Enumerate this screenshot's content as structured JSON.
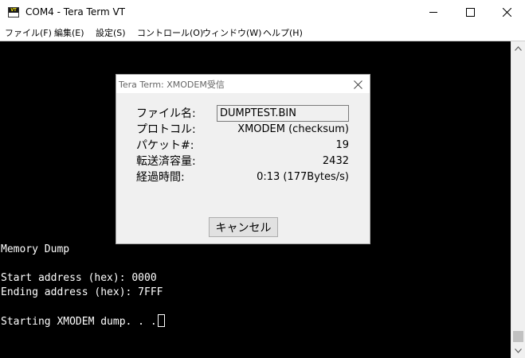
{
  "window": {
    "title": "COM4 - Tera Term VT",
    "icon_text": "VT"
  },
  "menu": {
    "items": [
      {
        "label": "ファイル(F)"
      },
      {
        "label": "編集(E)"
      },
      {
        "label": "設定(S)"
      },
      {
        "label": "コントロール(O)"
      },
      {
        "label": "ウィンドウ(W)"
      },
      {
        "label": "ヘルプ(H)"
      }
    ]
  },
  "terminal": {
    "lines": [
      "Memory Dump",
      "",
      "Start address (hex): 0000",
      "Ending address (hex): 7FFF",
      "",
      "Starting XMODEM dump. . ."
    ]
  },
  "dialog": {
    "title": "Tera Term: XMODEM受信",
    "fields": {
      "filename_label": "ファイル名:",
      "filename_value": "DUMPTEST.BIN",
      "protocol_label": "プロトコル:",
      "protocol_value": "XMODEM (checksum)",
      "packet_label": "パケット#:",
      "packet_value": "19",
      "bytes_label": "転送済容量:",
      "bytes_value": "2432",
      "elapsed_label": "経過時間:",
      "elapsed_value": "0:13 (177Bytes/s)"
    },
    "cancel_label": "キャンセル"
  },
  "colors": {
    "terminal_bg": "#000000",
    "terminal_fg": "#ffffff",
    "dialog_bg": "#f0f0f0"
  },
  "icons": {
    "minimize": "minimize-icon",
    "maximize": "maximize-icon",
    "close": "close-icon",
    "dialog_close": "close-icon",
    "scroll_up": "chevron-up-icon",
    "scroll_down": "chevron-down-icon"
  }
}
